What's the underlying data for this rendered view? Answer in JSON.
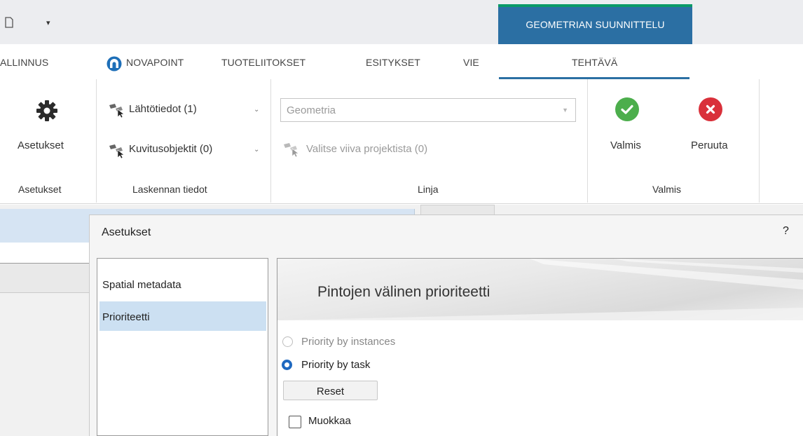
{
  "title_bar": {
    "context_tab": "GEOMETRIAN SUUNNITTELU",
    "quick_access_arrow": "▾"
  },
  "tabs": {
    "t1": "ALLINNUS",
    "t2": "NOVAPOINT",
    "t3": "TUOTELIITOKSET",
    "t4": "ESITYKSET",
    "t5": "VIE",
    "t6": "TEHTÄVÄ"
  },
  "ribbon": {
    "asetukset_button": "Asetukset",
    "asetukset_group": "Asetukset",
    "lahtotiedot": "Lähtötiedot (1)",
    "kuvitusobjektit": "Kuvitusobjektit (0)",
    "laskennan_group": "Laskennan tiedot",
    "geometria_value": "Geometria",
    "valitse_viiva": "Valitse viiva projektista (0)",
    "linja_group": "Linja",
    "valmis_button": "Valmis",
    "peruuta_button": "Peruuta",
    "valmis_group": "Valmis"
  },
  "dialog": {
    "title": "Asetukset",
    "help": "?",
    "nav": {
      "spatial": "Spatial metadata",
      "prioriteetti": "Prioriteetti"
    },
    "banner_title": "Pintojen välinen prioriteetti",
    "options": {
      "by_instances": "Priority by instances",
      "by_task": "Priority by task"
    },
    "reset": "Reset",
    "muokkaa": "Muokkaa"
  },
  "colors": {
    "context_tab": "#2b6fa3",
    "context_tab_accent": "#0a9a67",
    "valmis_green": "#4cae4c",
    "peruuta_red": "#d9303a",
    "nav_selected": "#cce0f2"
  },
  "icons": [
    "quick-access-icon",
    "novapoint-logo-icon",
    "gear-icon",
    "select-cursor-icon",
    "check-icon",
    "close-icon"
  ]
}
